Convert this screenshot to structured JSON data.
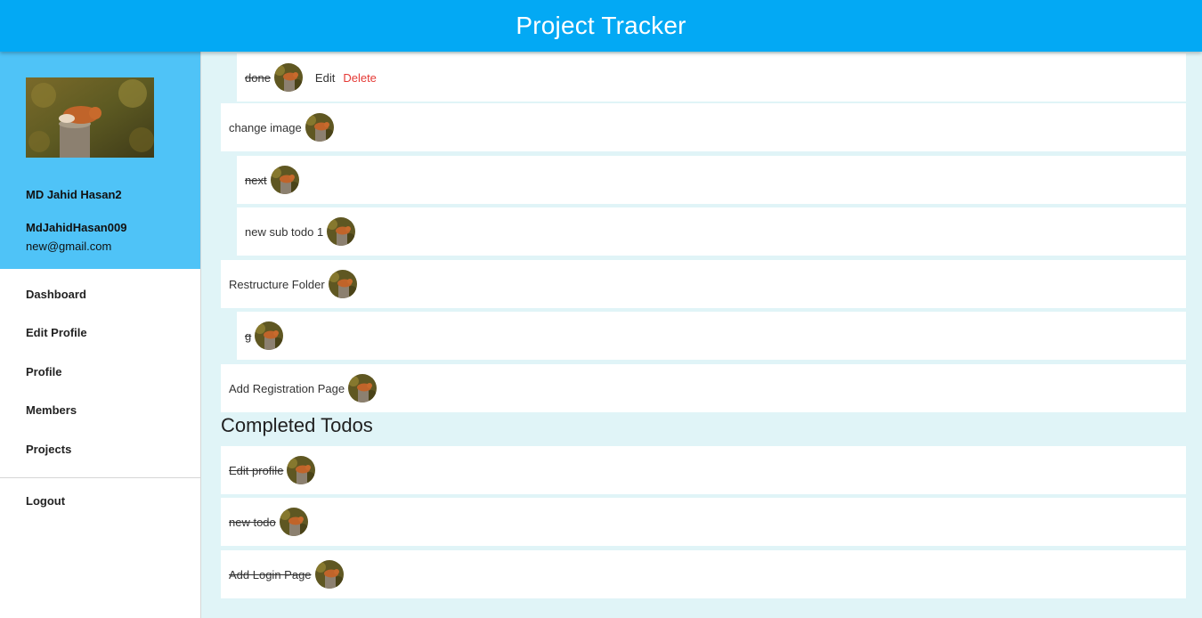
{
  "app": {
    "title": "Project Tracker"
  },
  "user": {
    "name": "MD Jahid Hasan2",
    "username": "MdJahidHasan009",
    "email": "new@gmail.com"
  },
  "nav": {
    "items": [
      "Dashboard",
      "Edit Profile",
      "Profile",
      "Members",
      "Projects"
    ],
    "logout": "Logout"
  },
  "todos": [
    {
      "text": "done",
      "done": true,
      "sub": true,
      "edit": "Edit",
      "delete": "Delete"
    },
    {
      "text": "change image",
      "done": false,
      "sub": false
    },
    {
      "text": "next",
      "done": true,
      "sub": true
    },
    {
      "text": "new sub todo 1",
      "done": false,
      "sub": true
    },
    {
      "text": "Restructure Folder",
      "done": false,
      "sub": false
    },
    {
      "text": "g",
      "done": true,
      "sub": true
    },
    {
      "text": "Add Registration Page",
      "done": false,
      "sub": false
    }
  ],
  "completed": {
    "title": "Completed Todos",
    "items": [
      "Edit profile",
      "new todo",
      "Add Login Page"
    ]
  },
  "icons": {
    "avatar": "fox-avatar-icon"
  },
  "colors": {
    "header": "#03a9f4",
    "profile_panel": "#4fc3f7",
    "background": "#e0f4f7",
    "delete": "#e53935"
  }
}
